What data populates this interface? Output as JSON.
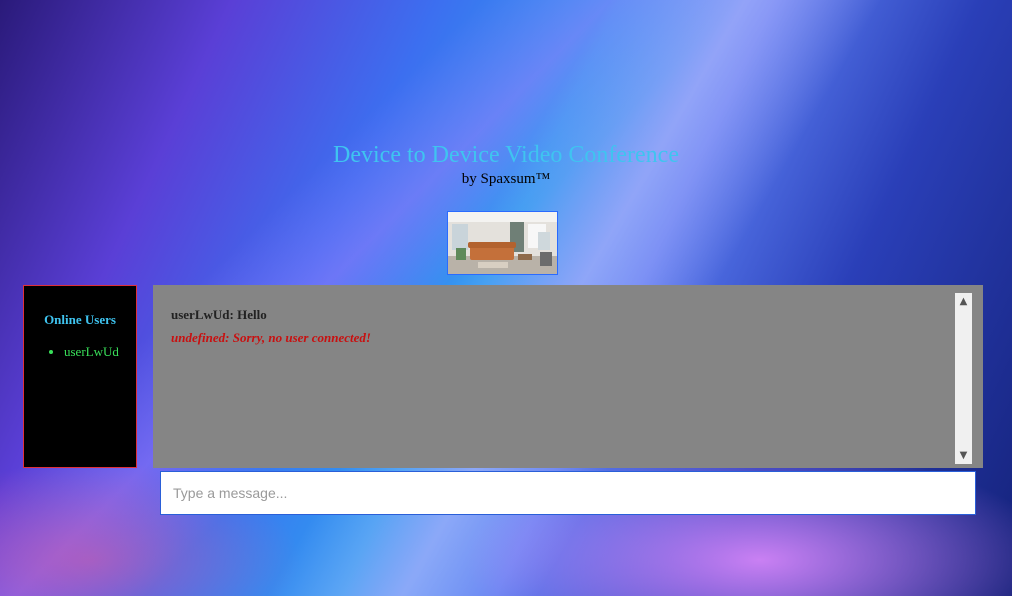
{
  "header": {
    "title": "Device to Device Video Conference",
    "byline": "by Spaxsum™"
  },
  "video": {
    "thumbnail_icon": "video-thumbnail-living-room"
  },
  "users_panel": {
    "title": "Online Users",
    "users": [
      "userLwUd"
    ]
  },
  "chat": {
    "messages": [
      {
        "text": "userLwUd: Hello",
        "kind": "normal"
      },
      {
        "text": "undefined: Sorry, no user connected!",
        "kind": "error"
      }
    ],
    "scroll_up_icon": "chevron-up-icon",
    "scroll_down_icon": "chevron-down-icon"
  },
  "composer": {
    "value": "",
    "placeholder": "Type a message..."
  },
  "colors": {
    "title": "#3fc4f0",
    "user_online": "#39e05a",
    "panel_border": "#e0303a",
    "error_text": "#c81010",
    "chat_bg": "#858585"
  }
}
